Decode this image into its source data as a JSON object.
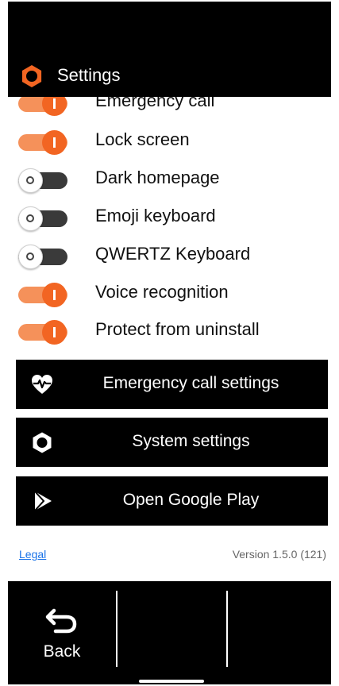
{
  "header": {
    "title": "Settings",
    "icon": "gear-icon"
  },
  "toggles": [
    {
      "label": "Emergency call",
      "on": true
    },
    {
      "label": "Lock screen",
      "on": true
    },
    {
      "label": "Dark homepage",
      "on": false
    },
    {
      "label": "Emoji keyboard",
      "on": false
    },
    {
      "label": "QWERTZ Keyboard",
      "on": false
    },
    {
      "label": "Voice recognition",
      "on": true
    },
    {
      "label": "Protect from uninstall",
      "on": true
    }
  ],
  "buttons": [
    {
      "label": "Emergency call settings",
      "icon": "heart-pulse-icon"
    },
    {
      "label": "System settings",
      "icon": "gear-icon"
    },
    {
      "label": "Open Google Play",
      "icon": "play-store-icon"
    }
  ],
  "footer": {
    "legal": "Legal",
    "version": "Version 1.5.0 (121)"
  },
  "nav": {
    "back_label": "Back",
    "back_icon": "back-arrow-icon"
  },
  "colors": {
    "accent": "#f26522",
    "accent_light": "#f5915a",
    "bar": "#000000",
    "link": "#1a73e8"
  }
}
